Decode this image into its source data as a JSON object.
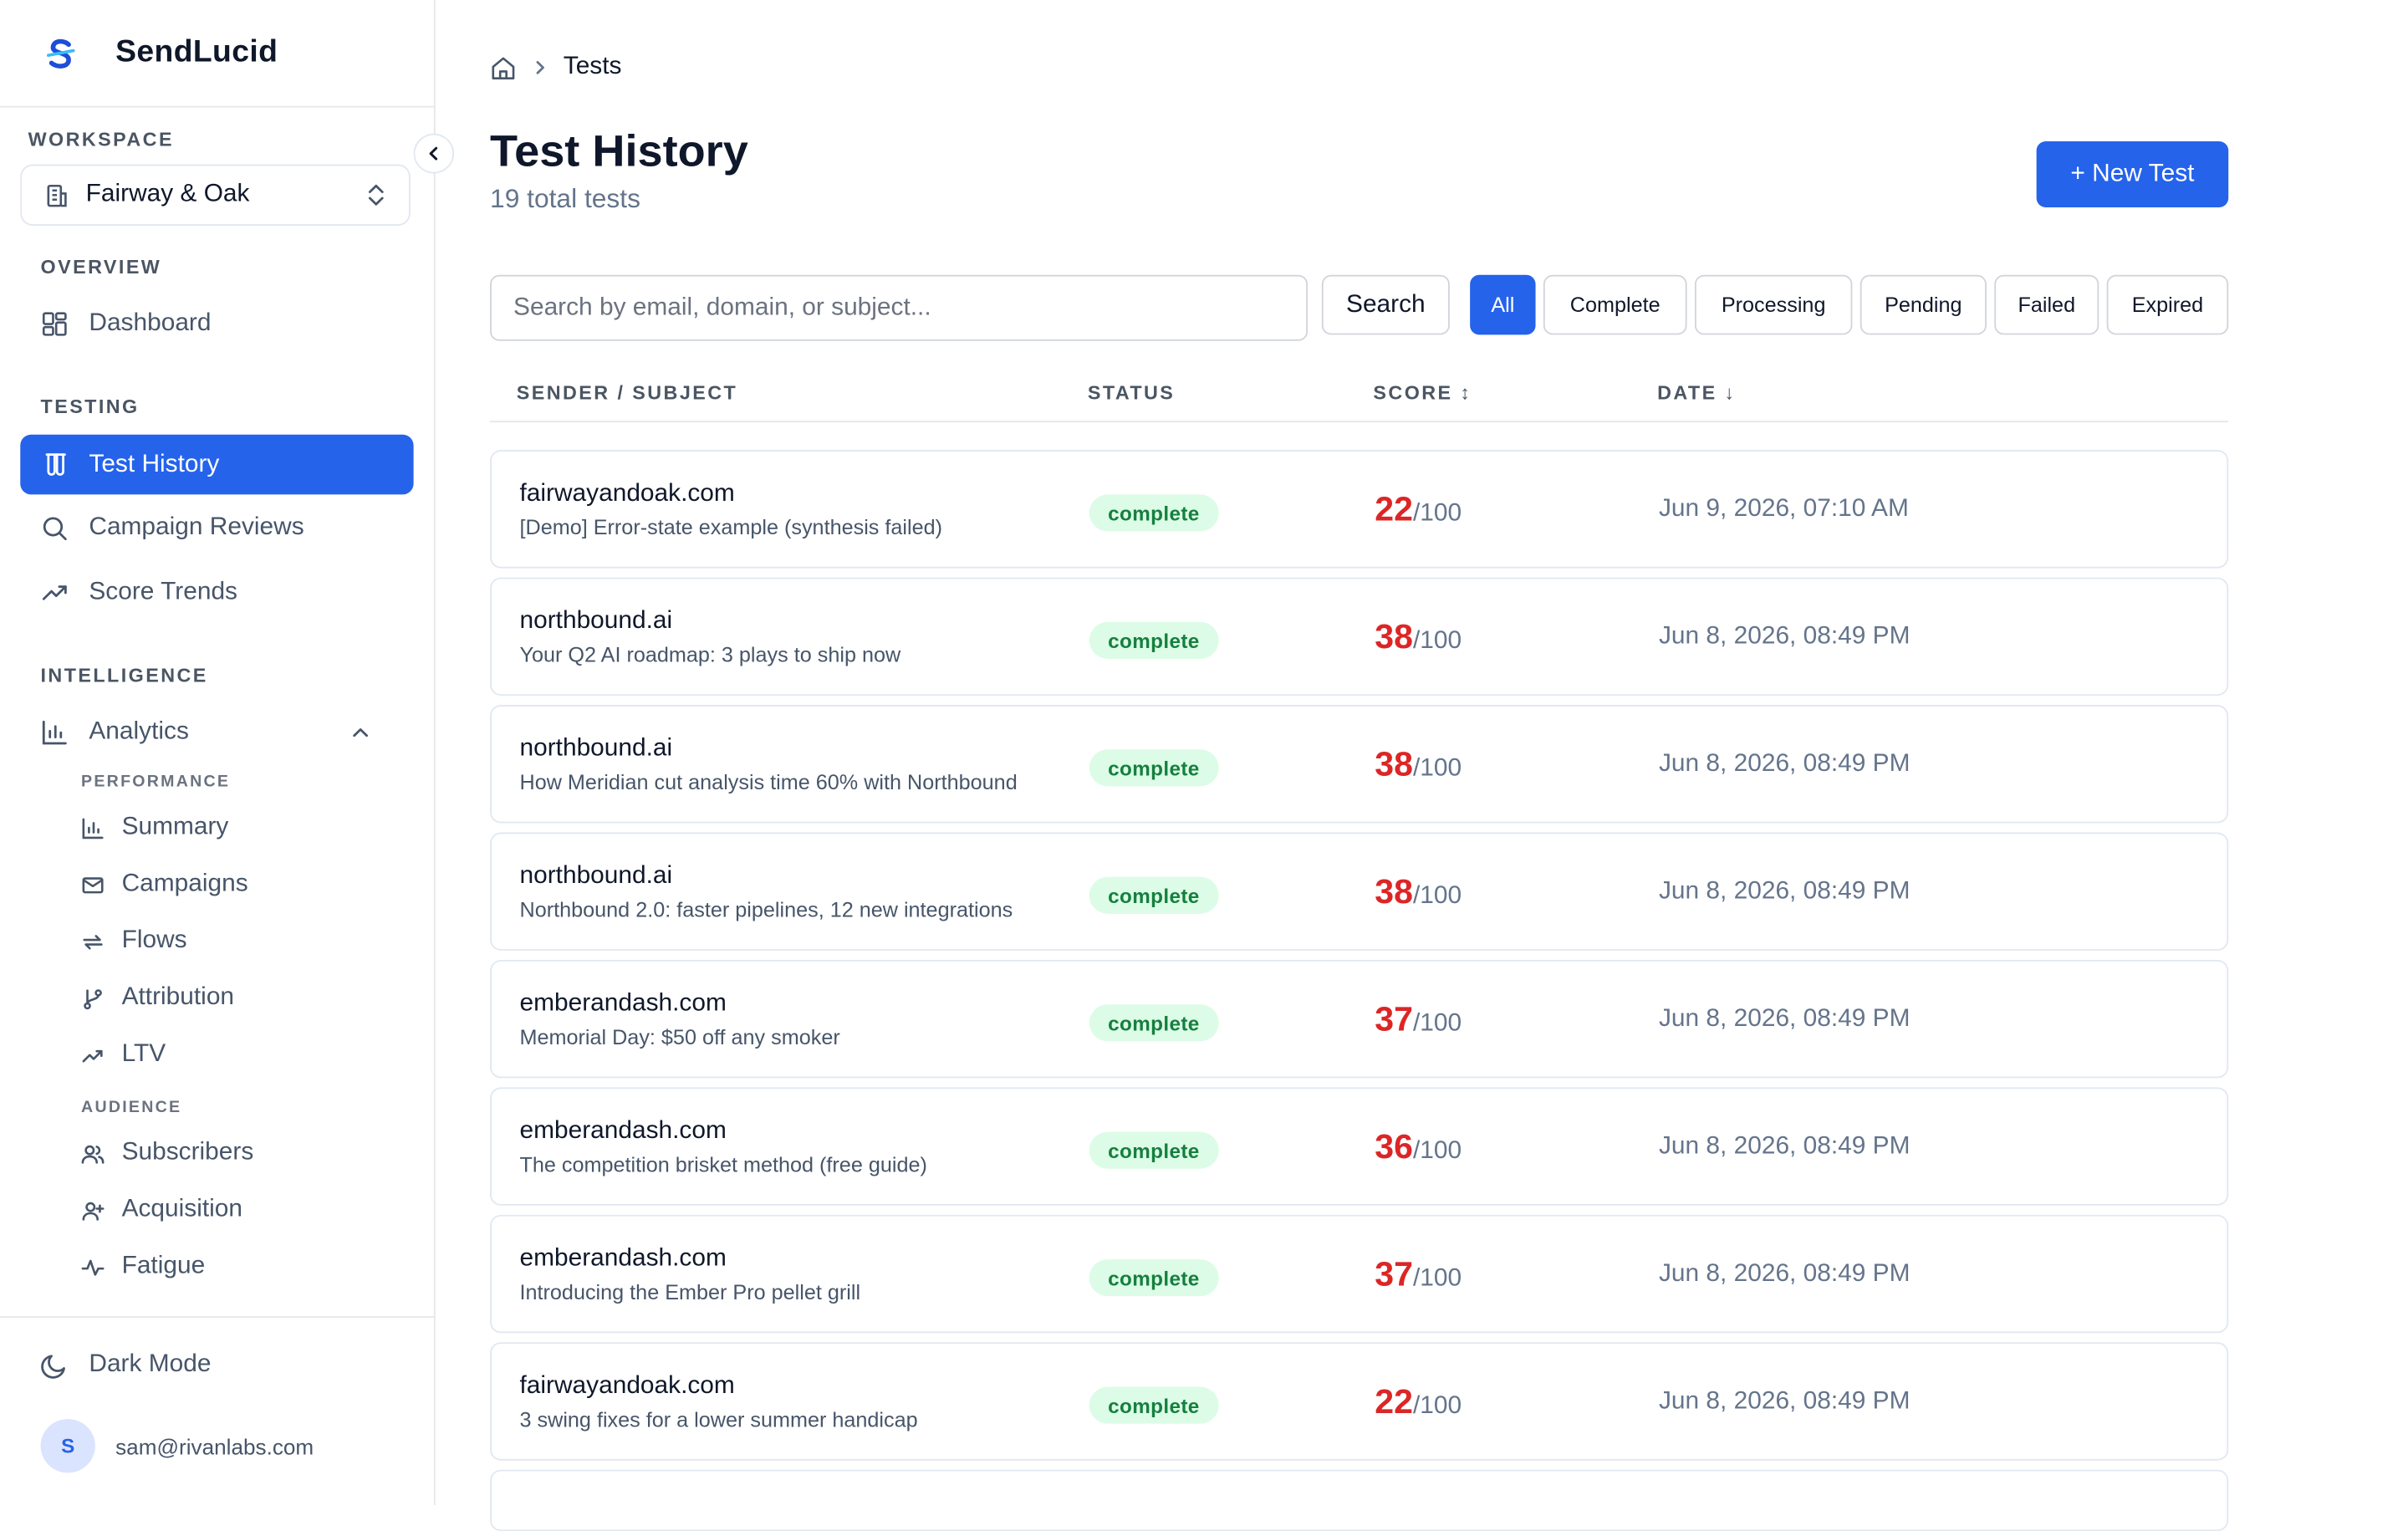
{
  "brand": {
    "name": "SendLucid",
    "accent": "#2563eb"
  },
  "sidebar": {
    "workspace_label": "WORKSPACE",
    "workspace_name": "Fairway & Oak",
    "overview_label": "OVERVIEW",
    "dashboard": "Dashboard",
    "testing_label": "TESTING",
    "test_history": "Test History",
    "campaign_reviews": "Campaign Reviews",
    "score_trends": "Score Trends",
    "intelligence_label": "INTELLIGENCE",
    "analytics": "Analytics",
    "performance_label": "PERFORMANCE",
    "performance_items": [
      "Summary",
      "Campaigns",
      "Flows",
      "Attribution",
      "LTV"
    ],
    "audience_label": "AUDIENCE",
    "audience_items": [
      "Subscribers",
      "Acquisition",
      "Fatigue"
    ],
    "dark_mode": "Dark Mode",
    "user_initial": "S",
    "user_email": "sam@rivanlabs.com"
  },
  "breadcrumb": {
    "current": "Tests"
  },
  "header": {
    "title": "Test History",
    "subtitle": "19 total tests",
    "new_test": "+ New Test"
  },
  "search": {
    "placeholder": "Search by email, domain, or subject...",
    "button": "Search"
  },
  "filters": [
    "All",
    "Complete",
    "Processing",
    "Pending",
    "Failed",
    "Expired"
  ],
  "table": {
    "headers": {
      "sender": "SENDER / SUBJECT",
      "status": "STATUS",
      "score": "SCORE ↕",
      "date": "DATE ↓"
    },
    "score_suffix": "/100",
    "rows": [
      {
        "sender": "fairwayandoak.com",
        "subject": "[Demo] Error-state example (synthesis failed)",
        "status": "complete",
        "score": "22",
        "date": "Jun 9, 2026, 07:10 AM"
      },
      {
        "sender": "northbound.ai",
        "subject": "Your Q2 AI roadmap: 3 plays to ship now",
        "status": "complete",
        "score": "38",
        "date": "Jun 8, 2026, 08:49 PM"
      },
      {
        "sender": "northbound.ai",
        "subject": "How Meridian cut analysis time 60% with Northbound",
        "status": "complete",
        "score": "38",
        "date": "Jun 8, 2026, 08:49 PM"
      },
      {
        "sender": "northbound.ai",
        "subject": "Northbound 2.0: faster pipelines, 12 new integrations",
        "status": "complete",
        "score": "38",
        "date": "Jun 8, 2026, 08:49 PM"
      },
      {
        "sender": "emberandash.com",
        "subject": "Memorial Day: $50 off any smoker",
        "status": "complete",
        "score": "37",
        "date": "Jun 8, 2026, 08:49 PM"
      },
      {
        "sender": "emberandash.com",
        "subject": "The competition brisket method (free guide)",
        "status": "complete",
        "score": "36",
        "date": "Jun 8, 2026, 08:49 PM"
      },
      {
        "sender": "emberandash.com",
        "subject": "Introducing the Ember Pro pellet grill",
        "status": "complete",
        "score": "37",
        "date": "Jun 8, 2026, 08:49 PM"
      },
      {
        "sender": "fairwayandoak.com",
        "subject": "3 swing fixes for a lower summer handicap",
        "status": "complete",
        "score": "22",
        "date": "Jun 8, 2026, 08:49 PM"
      }
    ]
  }
}
